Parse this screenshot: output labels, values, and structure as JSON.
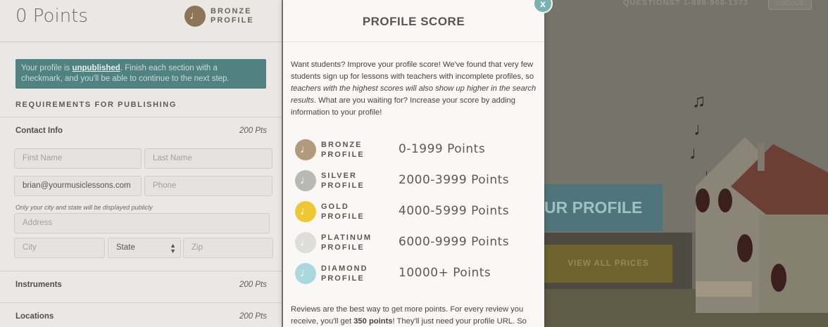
{
  "left": {
    "points": "0 Points",
    "badge_line1": "BRONZE",
    "badge_line2": "PROFILE",
    "notice_prefix": "Your profile is ",
    "notice_link": "unpublished",
    "notice_suffix": ". Finish each section with a checkmark, and you'll be able to continue to the next step.",
    "requirements_heading": "REQUIREMENTS FOR PUBLISHING",
    "sections": [
      {
        "name": "Contact Info",
        "pts": "200 Pts"
      },
      {
        "name": "Instruments",
        "pts": "200 Pts"
      },
      {
        "name": "Locations",
        "pts": "200 Pts"
      }
    ],
    "fields": {
      "first_name": "First Name",
      "last_name": "Last Name",
      "email": "brian@yourmusiclessons.com",
      "phone": "Phone",
      "hint": "Only your city and state will be displayed publicly",
      "address": "Address",
      "city": "City",
      "state": "State",
      "zip": "Zip"
    }
  },
  "right": {
    "question": "QUESTIONS? 1-888-908-1373",
    "logout": "LOGOUT",
    "cta": "UR PROFILE",
    "view_prices": "VIEW ALL PRICES"
  },
  "modal": {
    "close": "x",
    "title": "PROFILE SCORE",
    "intro_plain1": "Want students? Improve your profile score! We've found that very few students sign up for lessons with teachers with incomplete profiles, so ",
    "intro_italic": "teachers with the highest scores will also show up higher in the search results",
    "intro_plain2": ". What are you waiting for? Increase your score by adding information to your profile!",
    "tiers": [
      {
        "line1": "BRONZE",
        "line2": "PROFILE",
        "range": "0-1999 Points",
        "color": "#b29a7a"
      },
      {
        "line1": "SILVER",
        "line2": "PROFILE",
        "range": "2000-3999 Points",
        "color": "#b8b8b5"
      },
      {
        "line1": "GOLD",
        "line2": "PROFILE",
        "range": "4000-5999 Points",
        "color": "#eec735"
      },
      {
        "line1": "PLATINUM",
        "line2": "PROFILE",
        "range": "6000-9999 Points",
        "color": "#dddddb"
      },
      {
        "line1": "DIAMOND",
        "line2": "PROFILE",
        "range": "10000+ Points",
        "color": "#a9d8de"
      }
    ],
    "reviews_plain1": "Reviews are the best way to get more points. For every review you receive, you'll get ",
    "reviews_bold": "350 points",
    "reviews_plain2": "! They'll just need your profile URL. So"
  },
  "icons": {
    "note": "♩",
    "music_note": "♫"
  }
}
